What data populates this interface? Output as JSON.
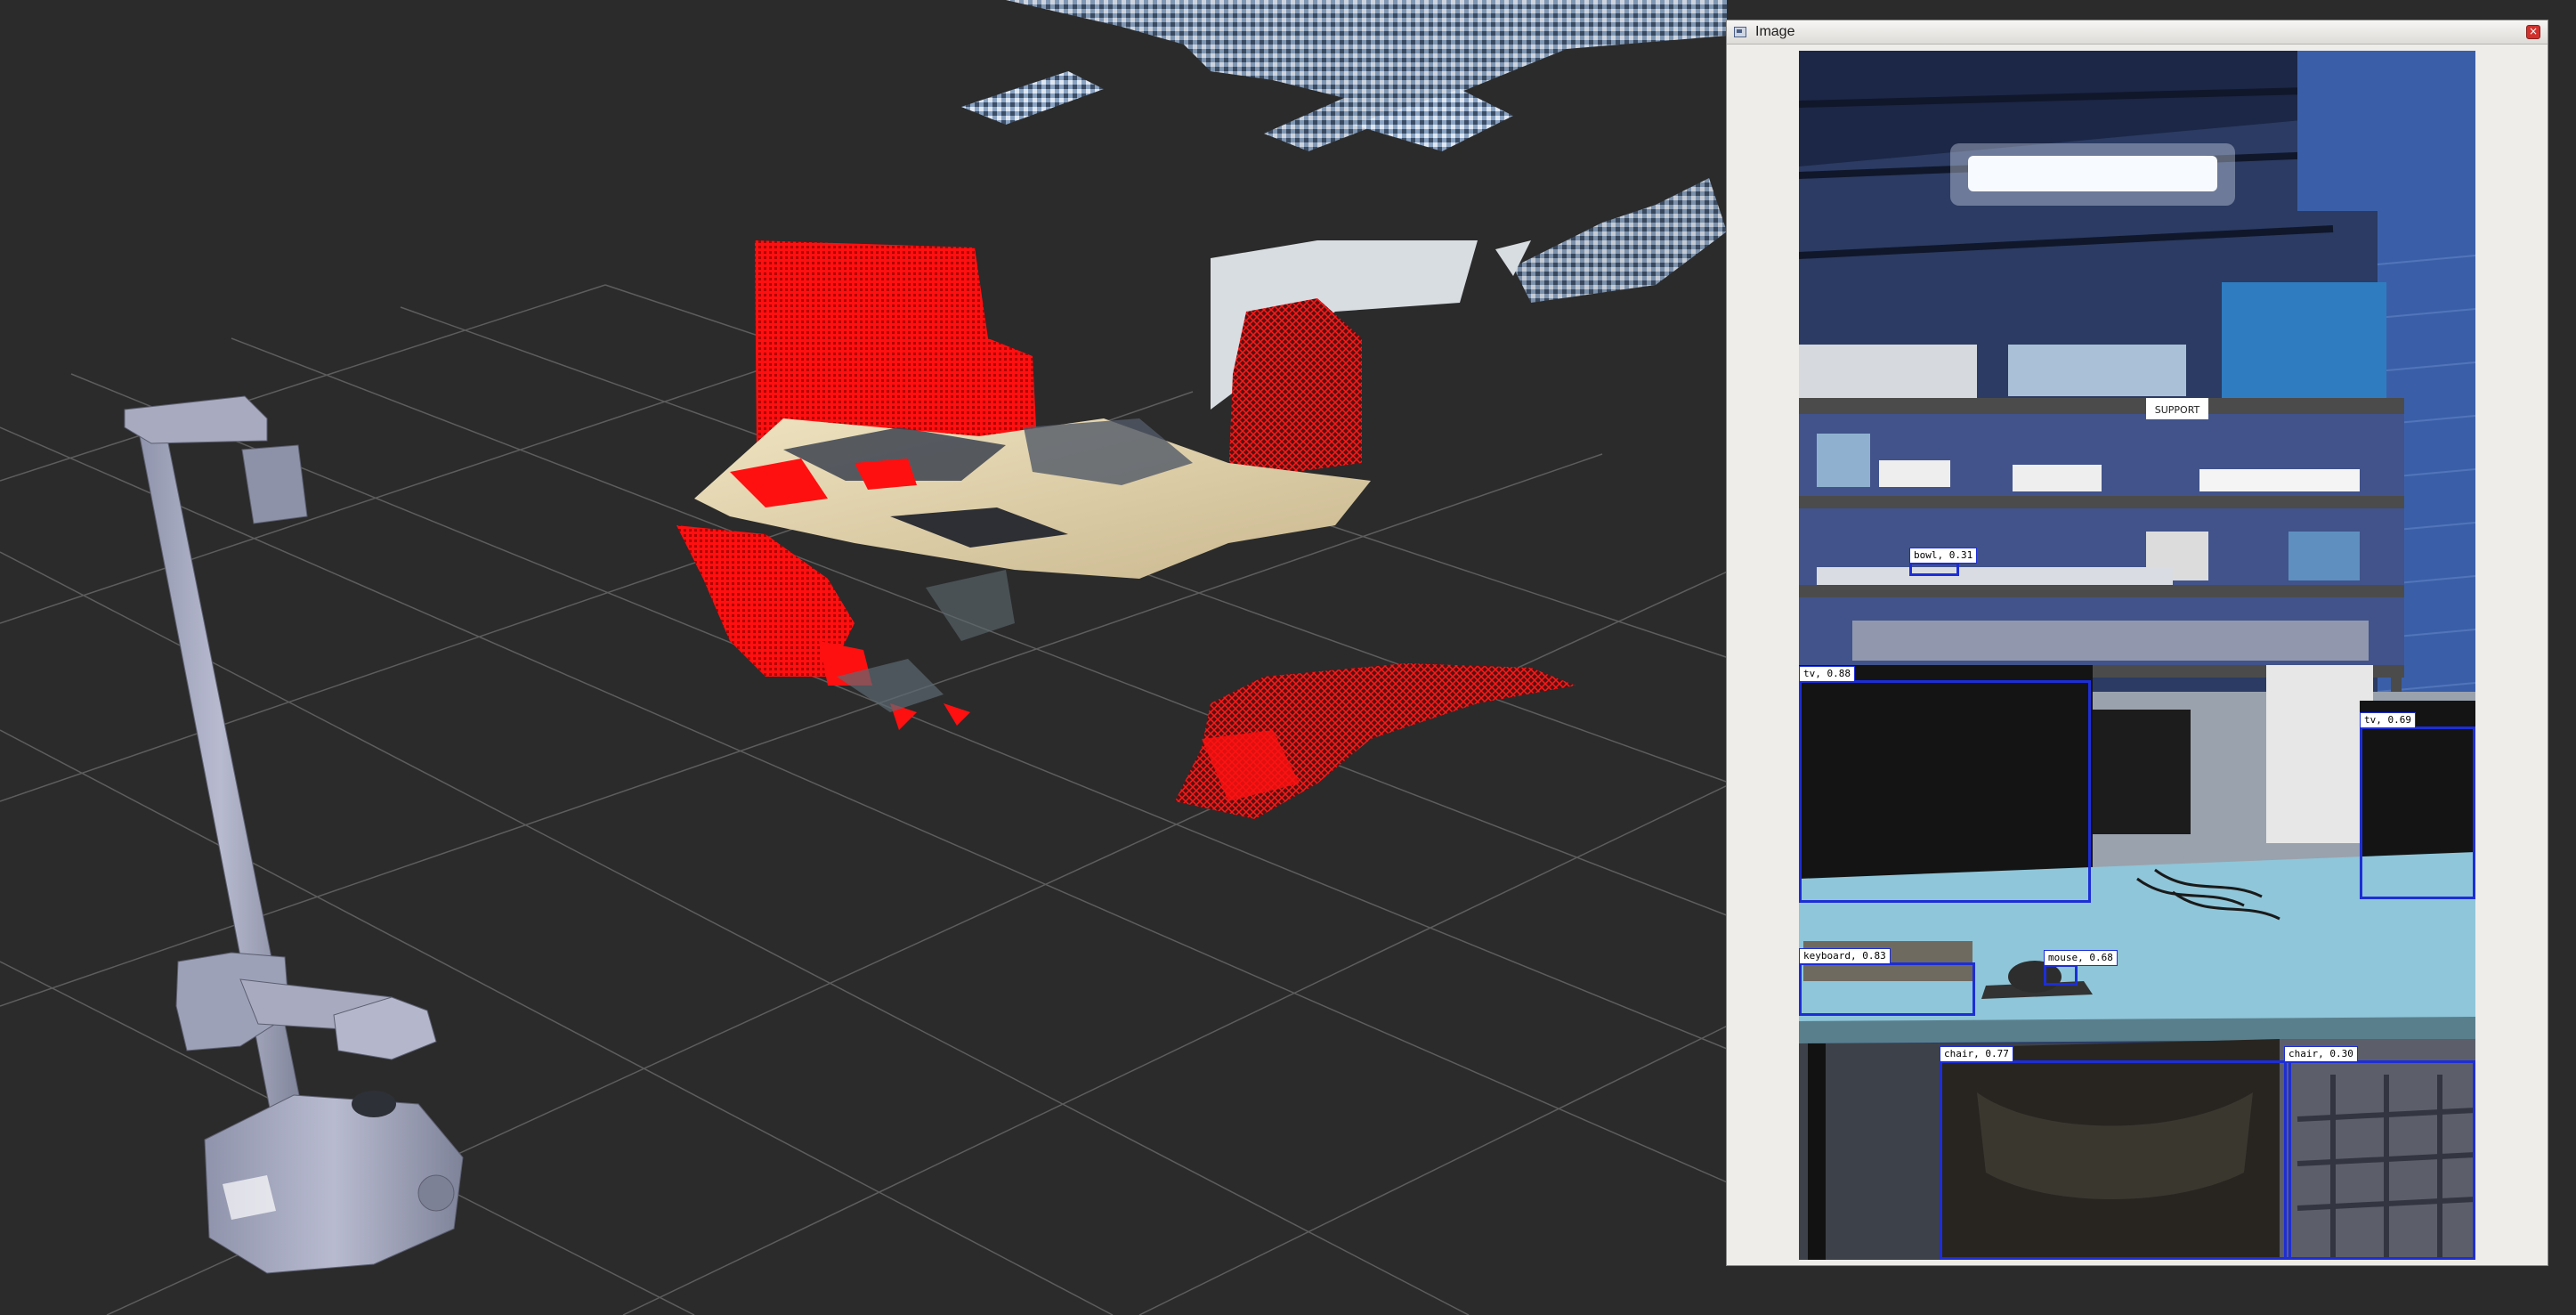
{
  "window": {
    "title": "Image",
    "close_glyph": "×",
    "icon": "image-window-icon"
  },
  "detections": [
    {
      "label": "bowl, 0.31"
    },
    {
      "label": "tv, 0.88"
    },
    {
      "label": "tv, 0.69"
    },
    {
      "label": "keyboard, 0.83"
    },
    {
      "label": "mouse, 0.68"
    },
    {
      "label": "chair, 0.77"
    },
    {
      "label": "chair, 0.30"
    }
  ],
  "scene_signs": {
    "support": "SUPPORT"
  },
  "colors": {
    "viewport_bg": "#2b2b2b",
    "grid": "#6a6a6a",
    "highlight_red": "#ff1010",
    "robot": "#9da1b8",
    "detection_box": "#1d2ed6"
  }
}
